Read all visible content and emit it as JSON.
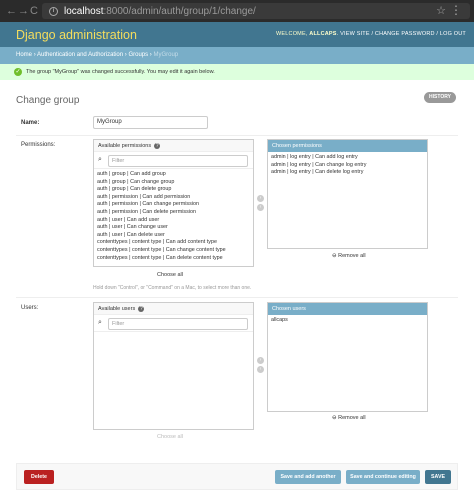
{
  "browser": {
    "host": "localhost",
    "path": ":8000/admin/auth/group/1/change/",
    "back": "←",
    "forward": "→",
    "reload": "C",
    "info": "i",
    "star": "☆",
    "menu": "⋮"
  },
  "header": {
    "brand": "Django administration",
    "welcome": "WELCOME,",
    "user": "ALLCAPS",
    "links": ". VIEW SITE / CHANGE PASSWORD / LOG OUT"
  },
  "breadcrumb": {
    "home": "Home",
    "sep": "›",
    "app": "Authentication and Authorization",
    "model": "Groups",
    "current": "MyGroup"
  },
  "message": {
    "icon": "✓",
    "text": "The group \"MyGroup\" was changed successfully. You may edit it again below."
  },
  "page": {
    "title": "Change group",
    "history": "HISTORY"
  },
  "form": {
    "name_label": "Name:",
    "name_value": "MyGroup",
    "permissions_label": "Permissions:",
    "available_permissions": "Available permissions",
    "help_icon": "?",
    "filter_placeholder": "Filter",
    "permissions": [
      "auth | group | Can add group",
      "auth | group | Can change group",
      "auth | group | Can delete group",
      "auth | permission | Can add permission",
      "auth | permission | Can change permission",
      "auth | permission | Can delete permission",
      "auth | user | Can add user",
      "auth | user | Can change user",
      "auth | user | Can delete user",
      "contenttypes | content type | Can add content type",
      "contenttypes | content type | Can change content type",
      "contenttypes | content type | Can delete content type"
    ],
    "chosen_permissions": "Chosen permissions",
    "chosen_permission_items": [
      "admin | log entry | Can add log entry",
      "admin | log entry | Can change log entry",
      "admin | log entry | Can delete log entry"
    ],
    "choose_all": "Choose all",
    "remove_all": "Remove all",
    "help_text": "Hold down \"Control\", or \"Command\" on a Mac, to select more than one.",
    "users_label": "Users:",
    "available_users": "Available users",
    "chosen_users": "Chosen users",
    "chosen_user_items": [
      "allcaps"
    ]
  },
  "actions": {
    "delete": "Delete",
    "save_add": "Save and add another",
    "save_continue": "Save and continue editing",
    "save": "SAVE"
  },
  "colors": {
    "header": "#417690",
    "brand": "#f5dd5d",
    "breadcrumb": "#79aec8",
    "success": "#dfd",
    "delete": "#ba2121",
    "save": "#417690",
    "secondary": "#79aec8"
  }
}
